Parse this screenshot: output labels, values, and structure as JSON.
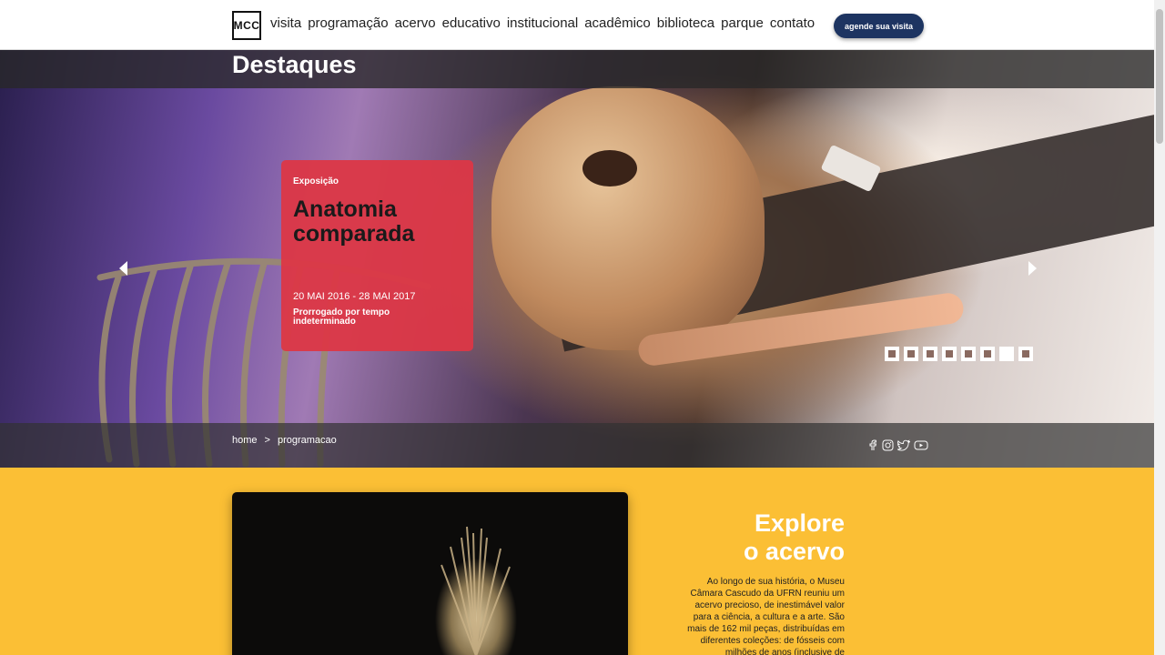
{
  "header": {
    "logo_text": "MCC",
    "nav": [
      "visita",
      "programação",
      "acervo",
      "educativo",
      "institucional",
      "acadêmico",
      "biblioteca",
      "parque",
      "contato"
    ],
    "cta_label": "agende sua visita"
  },
  "hero": {
    "title": "Destaques",
    "card": {
      "category": "Exposição",
      "title": "Anatomia comparada",
      "dates": "20 MAI 2016 - 28 MAI 2017",
      "note": "Prorrogado por tempo indeterminado"
    },
    "slide_count": 8,
    "active_slide": 7,
    "breadcrumb": [
      "home",
      ">",
      "programacao"
    ],
    "social_icons": [
      "facebook-icon",
      "instagram-icon",
      "twitter-icon",
      "youtube-icon"
    ]
  },
  "explore": {
    "title_line1": "Explore",
    "title_line2": "o acervo",
    "text": "Ao longo de sua história, o Museu Câmara Cascudo da UFRN reuniu um acervo precioso, de inestimável valor para a ciência, a cultura e a arte. São mais de 162 mil peças, distribuídas em diferentes coleções: de fósseis com milhões de anos (inclusive de"
  },
  "colors": {
    "accent_navy": "#1d3461",
    "card_red": "#dc3746",
    "section_yellow": "#fbbf35"
  }
}
